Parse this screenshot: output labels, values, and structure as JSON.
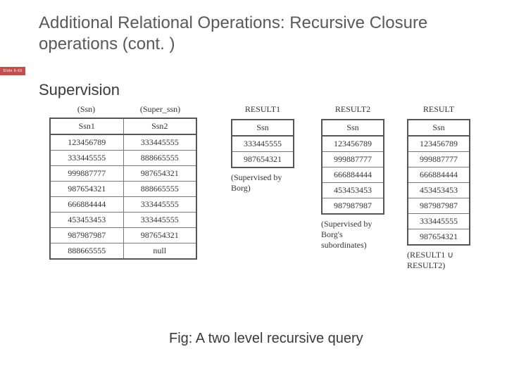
{
  "title": "Additional Relational Operations: Recursive Closure operations (cont. )",
  "badge": "Slide 6-65",
  "subtitle": "Supervision",
  "caption": "Fig: A two level recursive query",
  "super_table": {
    "paren_left": "(Ssn)",
    "paren_right": "(Super_ssn)",
    "headers": [
      "Ssn1",
      "Ssn2"
    ],
    "rows": [
      [
        "123456789",
        "333445555"
      ],
      [
        "333445555",
        "888665555"
      ],
      [
        "999887777",
        "987654321"
      ],
      [
        "987654321",
        "888665555"
      ],
      [
        "666884444",
        "333445555"
      ],
      [
        "453453453",
        "333445555"
      ],
      [
        "987987987",
        "987654321"
      ],
      [
        "888665555",
        "null"
      ]
    ]
  },
  "result1": {
    "label": "RESULT1",
    "header": "Ssn",
    "rows": [
      "333445555",
      "987654321"
    ],
    "note": "(Supervised by Borg)"
  },
  "result2": {
    "label": "RESULT2",
    "header": "Ssn",
    "rows": [
      "123456789",
      "999887777",
      "666884444",
      "453453453",
      "987987987"
    ],
    "note": "(Supervised by Borg's subordinates)"
  },
  "result": {
    "label": "RESULT",
    "header": "Ssn",
    "rows": [
      "123456789",
      "999887777",
      "666884444",
      "453453453",
      "987987987",
      "333445555",
      "987654321"
    ],
    "note": "(RESULT1 ∪ RESULT2)"
  }
}
